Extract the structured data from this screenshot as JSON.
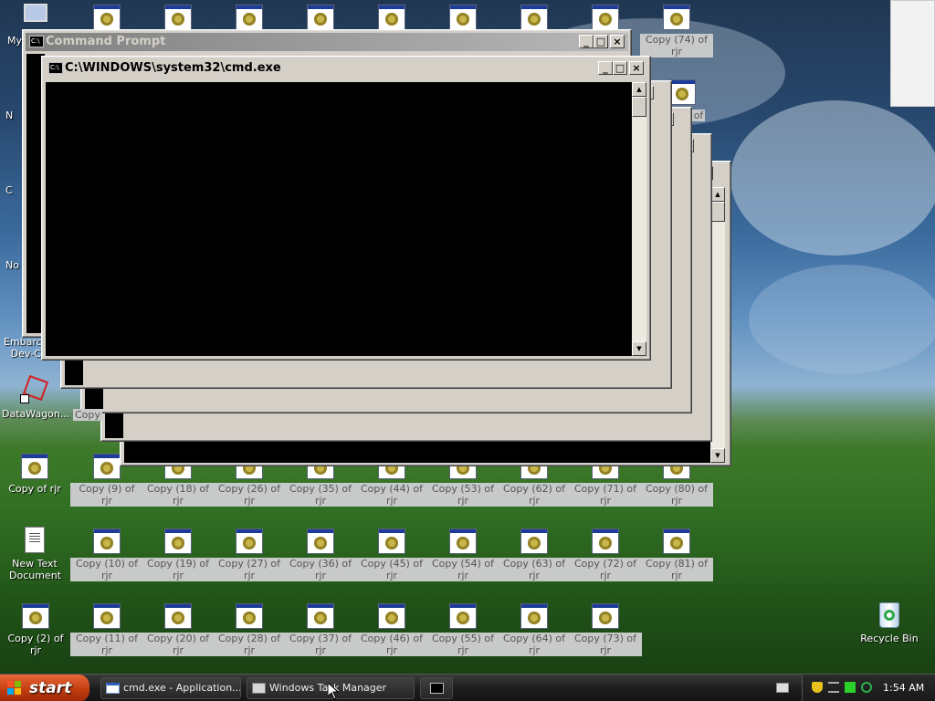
{
  "colors": {
    "titlebar_active": "#d4d0c8",
    "titlebar_inactive": "#808080",
    "console_bg": "#000000",
    "start_button": "#c33d10",
    "taskbar": "#1e1e1e",
    "selection_label_bg": "#c8cac9"
  },
  "desktop": {
    "top_icon_label": "My",
    "left_partial_labels": [
      "N",
      "C",
      "No"
    ],
    "left_icons": [
      {
        "label": "Embarca Dev-C",
        "icon": "shortcut-icon"
      },
      {
        "label": "DataWagon...",
        "icon": "datawagon-shortcut-icon"
      },
      {
        "label": "Copy of rjr",
        "icon": "exe-icon"
      },
      {
        "label": "New Text Document",
        "icon": "text-document-icon"
      },
      {
        "label": "Copy (2) of rjr",
        "icon": "exe-icon"
      }
    ],
    "rjr_row_top": {
      "labels": [
        "Copy (74) of rjr"
      ]
    },
    "row1": [
      "Copy (9) of rjr",
      "Copy (18) of rjr",
      "Copy (26) of rjr",
      "Copy (35) of rjr",
      "Copy (44) of rjr",
      "Copy (53) of rjr",
      "Copy (62) of rjr",
      "Copy (71) of rjr",
      "Copy (80) of rjr"
    ],
    "row2": [
      "Copy (10) of rjr",
      "Copy (19) of rjr",
      "Copy (27) of rjr",
      "Copy (36) of rjr",
      "Copy (45) of rjr",
      "Copy (54) of rjr",
      "Copy (63) of rjr",
      "Copy (72) of rjr",
      "Copy (81) of rjr"
    ],
    "row3": [
      "Copy (11) of rjr",
      "Copy (20) of rjr",
      "Copy (28) of rjr",
      "Copy (37) of rjr",
      "Copy (46) of rjr",
      "Copy (55) of rjr",
      "Copy (64) of rjr",
      "Copy (73) of rjr"
    ],
    "partial_copy_label": "Copy",
    "partial_of_label": "of",
    "recycle_bin": "Recycle Bin"
  },
  "windows": {
    "back_title": "Command Prompt",
    "front_title": "C:\\WINDOWS\\system32\\cmd.exe",
    "minimize": "_",
    "maximize": "□",
    "close": "×"
  },
  "taskbar": {
    "start_label": "start",
    "tasks": [
      {
        "label": "cmd.exe - Application...",
        "icon": "window-icon"
      },
      {
        "label": "Windows Task Manager",
        "icon": "task-manager-icon"
      },
      {
        "label": "",
        "icon": "cmd-icon"
      }
    ],
    "clock": "1:54 AM"
  }
}
